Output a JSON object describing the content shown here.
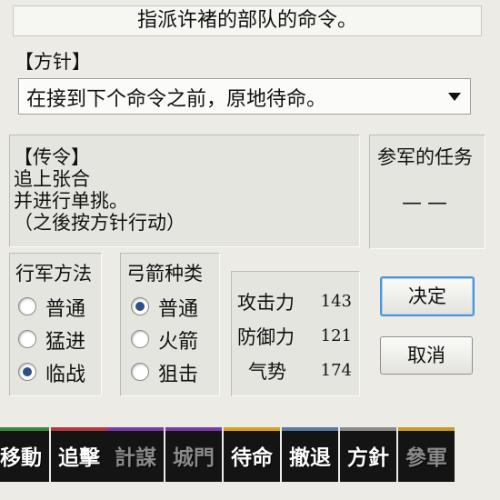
{
  "title": "指派许褚的部队的命令。",
  "policy": {
    "label": "【方针】",
    "selected": "在接到下个命令之前，原地待命。"
  },
  "order": {
    "label": "【传令】",
    "lines": [
      "追上张合",
      "并进行单挑。",
      "（之後按方针行动）"
    ]
  },
  "staff": {
    "label": "参军的任务",
    "value": "——"
  },
  "march": {
    "label": "行军方法",
    "options": [
      "普通",
      "猛进",
      "临战"
    ],
    "selected": "临战"
  },
  "arrow": {
    "label": "弓箭种类",
    "options": [
      "普通",
      "火箭",
      "狙击"
    ],
    "selected": "普通"
  },
  "stats": [
    {
      "name": "攻击力",
      "value": "143"
    },
    {
      "name": "防御力",
      "value": "121"
    },
    {
      "name": "气势",
      "value": "174"
    }
  ],
  "buttons": {
    "confirm": "决定",
    "cancel": "取消"
  },
  "commands": [
    {
      "label": "移動",
      "color": "#3b8a3c",
      "enabled": true
    },
    {
      "label": "追擊",
      "color": "#b33a3a",
      "enabled": true
    },
    {
      "label": "計謀",
      "color": "#7a3aa8",
      "enabled": true
    },
    {
      "label": "城門",
      "color": "#7a3aa8",
      "enabled": false
    },
    {
      "label": "待命",
      "color": "#d8a020",
      "enabled": true
    },
    {
      "label": "撤退",
      "color": "#5a7aa0",
      "enabled": true
    },
    {
      "label": "方針",
      "color": "#8a8a8a",
      "enabled": true
    },
    {
      "label": "參軍",
      "color": "#c79a2a",
      "enabled": false
    }
  ]
}
